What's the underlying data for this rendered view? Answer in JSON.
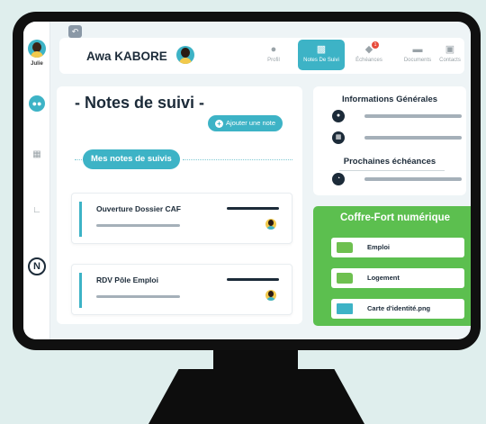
{
  "sidebar": {
    "user_label": "Julie",
    "items": [
      {
        "icon": "group-icon"
      },
      {
        "icon": "building-icon"
      },
      {
        "icon": "chart-icon"
      },
      {
        "icon": "logo-n-icon",
        "text": "N"
      }
    ]
  },
  "header": {
    "user_name": "Awa KABORE",
    "tabs": [
      {
        "label": "Profil",
        "icon": "person-icon"
      },
      {
        "label": "Notes De Suivi",
        "icon": "clipboard-icon",
        "active": true
      },
      {
        "label": "Échéances",
        "icon": "bell-icon",
        "badge": "1"
      },
      {
        "label": "Documents",
        "icon": "folder-icon"
      },
      {
        "label": "Contacts",
        "icon": "contact-card-icon"
      }
    ]
  },
  "notes": {
    "title": "- Notes de suivi -",
    "add_label": "Ajouter une note",
    "section_label": "Mes notes de suivis",
    "items": [
      {
        "title": "Ouverture Dossier CAF"
      },
      {
        "title": "RDV Pôle Emploi"
      }
    ]
  },
  "info": {
    "general_title": "Informations Générales",
    "deadlines_title": "Prochaines échéances"
  },
  "vault": {
    "title": "Coffre-Fort numérique",
    "documents": [
      {
        "label": "Emploi",
        "icon": "folder-icon"
      },
      {
        "label": "Logement",
        "icon": "folder-icon"
      },
      {
        "label": "Carte d'identité.png",
        "icon": "id-card-icon"
      }
    ]
  },
  "colors": {
    "accent": "#3db3c6",
    "dark": "#1c2b39",
    "vault_green": "#5cbf4f",
    "alert": "#e74c3c",
    "background": "#dfeeed"
  }
}
